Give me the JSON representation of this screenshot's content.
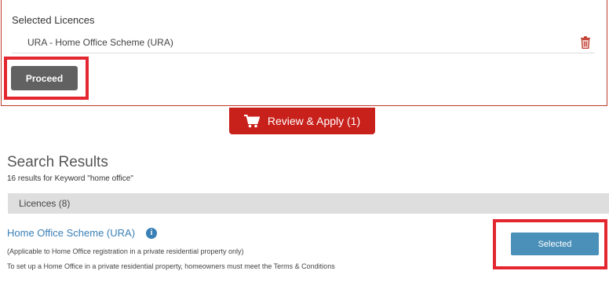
{
  "selected_panel": {
    "title": "Selected Licences",
    "items": [
      {
        "name": "URA - Home Office Scheme (URA)",
        "icon": "trash-icon"
      }
    ],
    "proceed_label": "Proceed"
  },
  "review_apply": {
    "label": "Review & Apply (1)",
    "icon": "cart-icon"
  },
  "search": {
    "title": "Search Results",
    "count_text": "16 results for Keyword \"home office\"",
    "tab_label": "Licences (8)"
  },
  "results": [
    {
      "title": "Home Office Scheme (URA)",
      "note": "(Applicable to Home Office registration in a private residential property only)",
      "description": "To set up a Home Office in a private residential property, homeowners must meet the Terms & Conditions",
      "button_label": "Selected",
      "icon": "info-icon"
    }
  ],
  "colors": {
    "accent_red": "#c8201b",
    "highlight_red": "#e3262f",
    "link_blue": "#3a7fb5",
    "selected_blue": "#4a90b8",
    "proceed_gray": "#616161"
  }
}
